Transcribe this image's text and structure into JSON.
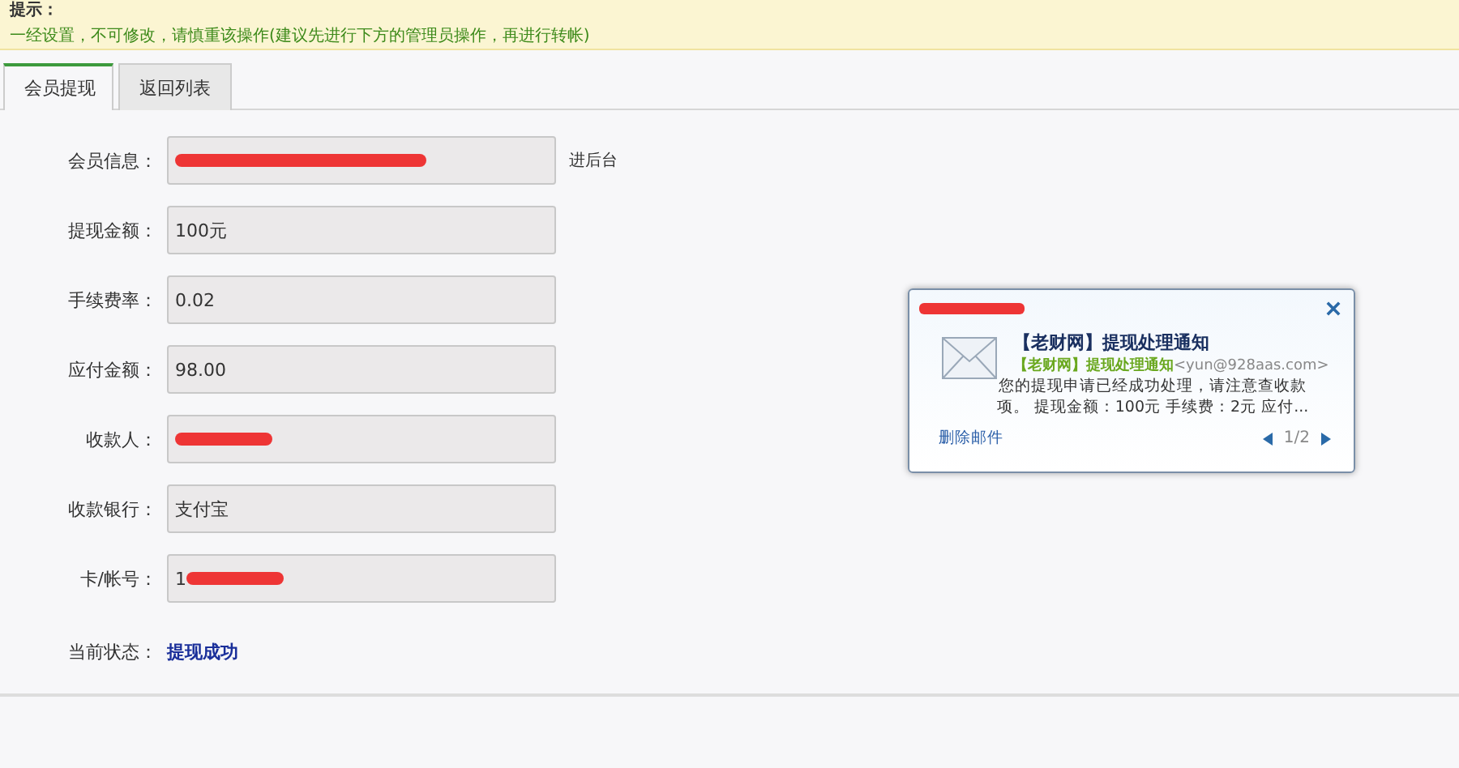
{
  "notice": {
    "title": "提示：",
    "text": "一经设置，不可修改，请慎重该操作(建议先进行下方的管理员操作，再进行转帐)"
  },
  "tabs": [
    {
      "label": "会员提现",
      "selected": true
    },
    {
      "label": "返回列表",
      "selected": false
    }
  ],
  "form": {
    "rows": [
      {
        "label": "会员信息：",
        "value": "",
        "redacted": true,
        "note": "进后台"
      },
      {
        "label": "提现金额：",
        "value": "100元",
        "redacted": false
      },
      {
        "label": "手续费率：",
        "value": "0.02",
        "redacted": false
      },
      {
        "label": "应付金额：",
        "value": "98.00",
        "redacted": false
      },
      {
        "label": "收款人：",
        "value": "",
        "redacted": true
      },
      {
        "label": "收款银行：",
        "value": "支付宝",
        "redacted": false
      },
      {
        "label": "卡/帐号：",
        "value": "1",
        "redacted": true
      }
    ],
    "status": {
      "label": "当前状态：",
      "value": "提现成功"
    }
  },
  "notification": {
    "sender_redacted": true,
    "title": "【老财网】提现处理通知",
    "from_name": "【老财网】提现处理通知",
    "from_address": "<yun@928aas.com>",
    "body": "您的提现申请已经成功处理，请注意查收款项。 提现金额：100元 手续费：2元 应付...",
    "delete_link": "删除邮件",
    "pager": "1/2"
  }
}
